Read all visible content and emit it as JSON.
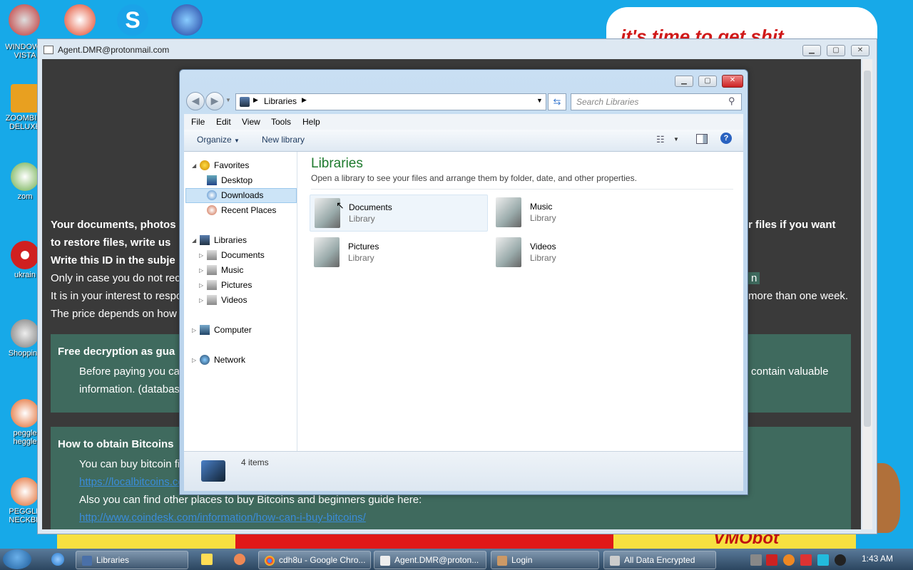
{
  "desktop": {
    "banner_text": "it's time to get shit",
    "icons": [
      {
        "label": "WINDOWS\nVISTA",
        "color": "#c02020"
      },
      {
        "label": "ZOOMBINI\nDELUXE",
        "color": "#e8a020"
      },
      {
        "label": "zom",
        "color": "#40a040"
      },
      {
        "label": "ukrain",
        "color": "#d02020"
      },
      {
        "label": "Shopping",
        "color": "#909090"
      },
      {
        "label": "peggle\nheggle",
        "color": "#e06020"
      },
      {
        "label": "PEGGLE\nNECKBE",
        "color": "#e06020"
      }
    ],
    "bottom_text": "VMObot"
  },
  "ransom_window": {
    "title": "Agent.DMR@protonmail.com",
    "lines": {
      "l1_left": "Your documents, photos",
      "l1_right": "r files if you want",
      "l2": "to restore files, write us",
      "l3": "Write this ID in the subje",
      "l4_left": "Only in case you do not rec",
      "l4_right": "n",
      "l5_left": "It is in your interest to respo",
      "l5_right": "more than one week.",
      "l6": "The price depends on how f"
    },
    "box1": {
      "heading": "Free decryption as gua",
      "text1_left": "Before paying you ca",
      "text1_right": "contain valuable",
      "text2": "information. (databas"
    },
    "box2": {
      "heading": "How to obtain Bitcoins",
      "text1": "You can buy bitcoin fi",
      "link1": "https://localbitcoins.con",
      "text2": "Also you can find other places to buy Bitcoins and beginners guide here:",
      "link2": "http://www.coindesk.com/information/how-can-i-buy-bitcoins/"
    }
  },
  "explorer": {
    "breadcrumb": "Libraries",
    "search_placeholder": "Search Libraries",
    "menu": [
      "File",
      "Edit",
      "View",
      "Tools",
      "Help"
    ],
    "toolbar": {
      "organize": "Organize",
      "new_library": "New library"
    },
    "nav": {
      "favorites": "Favorites",
      "desktop": "Desktop",
      "downloads": "Downloads",
      "recent": "Recent Places",
      "libraries": "Libraries",
      "documents": "Documents",
      "music": "Music",
      "pictures": "Pictures",
      "videos": "Videos",
      "computer": "Computer",
      "network": "Network"
    },
    "heading": "Libraries",
    "subheading": "Open a library to see your files and arrange them by folder, date, and other properties.",
    "libraries": [
      {
        "name": "Documents",
        "type": "Library"
      },
      {
        "name": "Music",
        "type": "Library"
      },
      {
        "name": "Pictures",
        "type": "Library"
      },
      {
        "name": "Videos",
        "type": "Library"
      }
    ],
    "status": "4 items"
  },
  "taskbar": {
    "buttons": [
      "Libraries",
      "cdh8u - Google Chro...",
      "Agent.DMR@proton...",
      "Login",
      "All Data Encrypted"
    ],
    "clock": "1:43 AM"
  }
}
